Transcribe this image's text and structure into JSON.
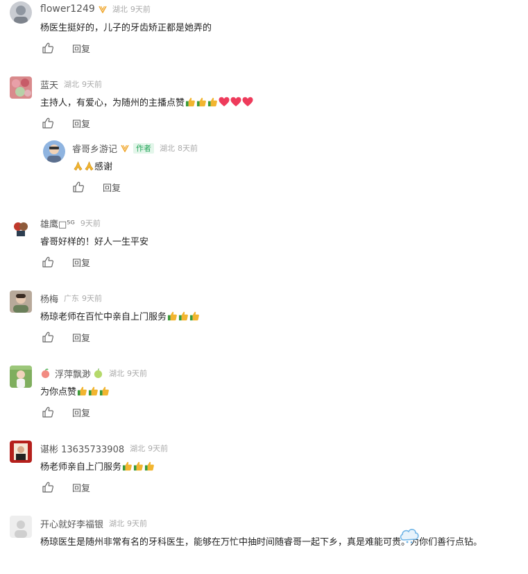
{
  "comments": [
    {
      "user": "flower1249",
      "location": "湖北",
      "time": "9天前",
      "verified": true,
      "text": "杨医生挺好的，儿子的牙齿矫正都是她弄的",
      "emojis": [],
      "reply_label": "回复"
    },
    {
      "user": "蓝天",
      "location": "湖北",
      "time": "9天前",
      "verified": false,
      "text": "主持人，有爱心，为随州的主播点赞",
      "emojis": [
        "thumbs-up",
        "thumbs-up",
        "thumbs-up",
        "heart",
        "heart",
        "heart"
      ],
      "reply_label": "回复",
      "reply": {
        "user": "睿哥乡游记",
        "author_tag": "作者",
        "location": "湖北",
        "time": "8天前",
        "verified": true,
        "text": "感谢",
        "emojis_before": [
          "pray",
          "pray"
        ],
        "reply_label": "回复"
      }
    },
    {
      "user": "雄鹰□⁵ᴳ",
      "location": "",
      "time": "9天前",
      "verified": false,
      "text": "睿哥好样的！好人一生平安",
      "emojis": [],
      "reply_label": "回复"
    },
    {
      "user": "杨梅",
      "location": "广东",
      "time": "9天前",
      "verified": false,
      "text": "杨琼老师在百忙中亲自上门服务",
      "emojis": [
        "thumbs-up",
        "thumbs-up",
        "thumbs-up"
      ],
      "reply_label": "回复"
    },
    {
      "user": "浮萍飘渺",
      "location": "湖北",
      "time": "9天前",
      "verified": false,
      "text": "为你点赞",
      "emojis": [
        "thumbs-up",
        "thumbs-up",
        "thumbs-up"
      ],
      "reply_label": "回复"
    },
    {
      "user": "谌彬 13635733908",
      "location": "湖北",
      "time": "9天前",
      "verified": false,
      "text": "杨老师亲自上门服务",
      "emojis": [
        "thumbs-up",
        "thumbs-up",
        "thumbs-up"
      ],
      "reply_label": "回复"
    },
    {
      "user": "开心就好李福银",
      "location": "湖北",
      "time": "9天前",
      "verified": false,
      "text": "杨琼医生是随州非常有名的牙科医生，能够在万忙中抽时间随睿哥一起下乡，真是难能可贵。为你们善行点钻。",
      "emojis": [],
      "reply_label": ""
    }
  ]
}
